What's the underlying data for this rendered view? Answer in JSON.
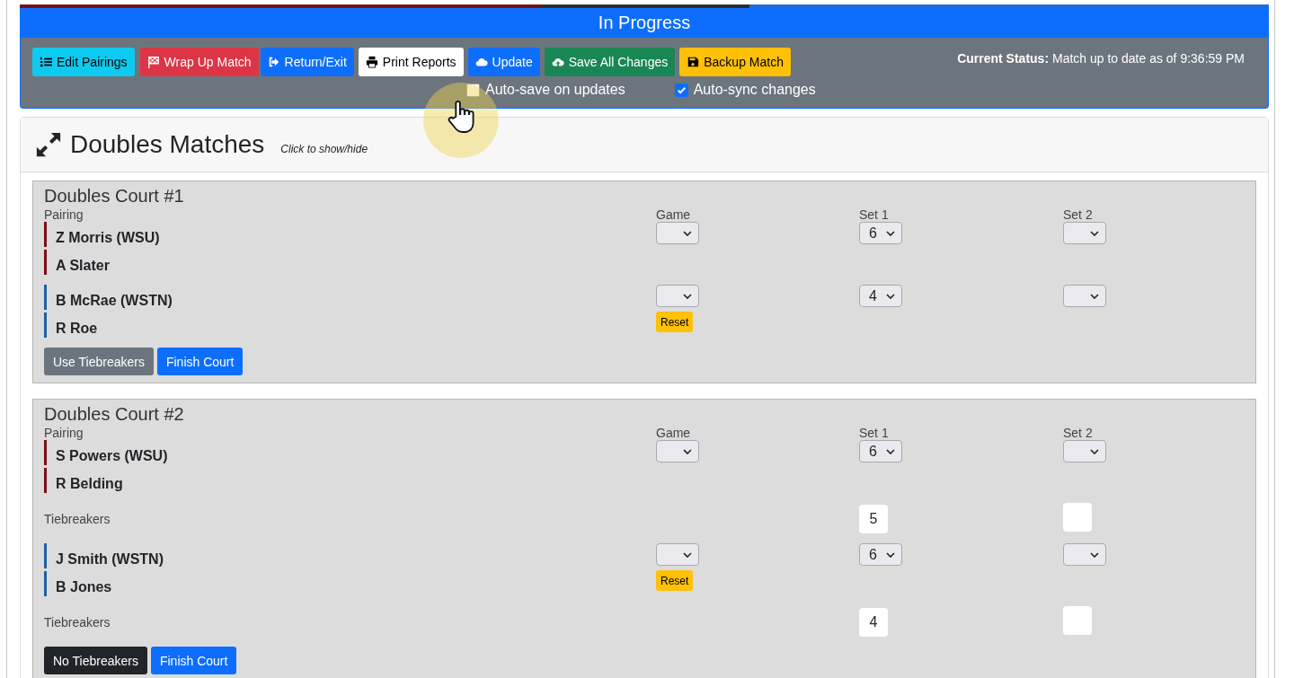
{
  "header": {
    "title": "In Progress"
  },
  "toolbar": {
    "buttons": [
      {
        "label": "Edit Pairings",
        "kind": "info"
      },
      {
        "label": "Wrap Up Match",
        "kind": "danger"
      },
      {
        "label": "Return/Exit",
        "kind": "primary"
      },
      {
        "label": "Print Reports",
        "kind": "light"
      },
      {
        "label": "Update",
        "kind": "primary"
      },
      {
        "label": "Save All Changes",
        "kind": "success"
      },
      {
        "label": "Backup Match",
        "kind": "warning"
      }
    ],
    "status": "**Current Status:** Match up to date as of 9:36:59 PM",
    "checkboxes": [
      {
        "label": "Auto-save on updates",
        "checked": false
      },
      {
        "label": "Auto-sync changes",
        "checked": true
      }
    ]
  },
  "section": {
    "title": "Doubles Matches",
    "hint": "Click to show/hide"
  },
  "courts": [
    {
      "title": "Doubles Court #1",
      "columns": [
        "Pairing",
        "Game",
        "Set 1",
        "Set 2"
      ],
      "teams": [
        {
          "color": "#7a0f14",
          "players": [
            "Z Morris (WSU)",
            "A Slater"
          ],
          "scores": {
            "set_1": "6"
          }
        },
        {
          "color": "#1a5fa8",
          "players": [
            "B McRae (WSTN)",
            "R Roe"
          ],
          "scores": {
            "set_1": "4"
          },
          "reset": "Reset"
        }
      ],
      "buttons": [
        {
          "label": "Use Tiebreakers",
          "kind": "secondary"
        },
        {
          "label": "Finish Court",
          "kind": "primary"
        }
      ]
    },
    {
      "title": "Doubles Court #2",
      "columns": [
        "Pairing",
        "Game",
        "Set 1",
        "Set 2"
      ],
      "teams": [
        {
          "color": "#7a0f14",
          "players": [
            "S Powers (WSU)",
            "R Belding"
          ],
          "scores": {
            "set_1": "6"
          },
          "tiebreakers": {
            "label": "Tiebreakers",
            "set_1": "5"
          }
        },
        {
          "color": "#1a5fa8",
          "players": [
            "J Smith (WSTN)",
            "B Jones"
          ],
          "scores": {
            "set_1": "6"
          },
          "reset": "Reset",
          "tiebreakers": {
            "label": "Tiebreakers",
            "set_1": "4"
          }
        }
      ],
      "buttons": [
        {
          "label": "No Tiebreakers",
          "kind": "dark"
        },
        {
          "label": "Finish Court",
          "kind": "primary"
        }
      ]
    }
  ]
}
